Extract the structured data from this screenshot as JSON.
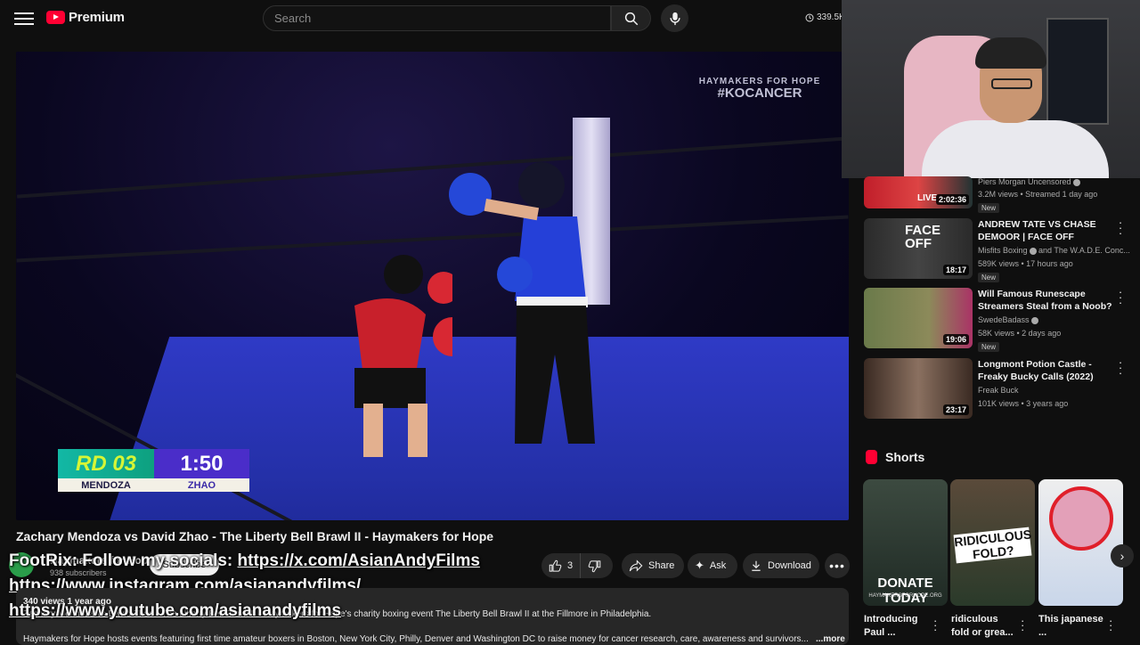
{
  "header": {
    "logo_text": "Premium",
    "search_placeholder": "Search",
    "viewers": "339.5K"
  },
  "video": {
    "title": "Zachary Mendoza vs David Zhao - The Liberty Bell Brawl II - Haymakers for Hope",
    "sponsor_line1": "HAYMAKERS FOR HOPE",
    "sponsor_line2": "#KOCANCER",
    "scoreboard": {
      "round": "RD 03",
      "time": "1:50",
      "fighter1": "MENDOZA",
      "fighter2": "ZHAO"
    }
  },
  "channel": {
    "name": "Haymakers for Hope",
    "subs": "938 subscribers",
    "subscribe_label": "Subscribe"
  },
  "overlay": {
    "line1_prefix": "FootRix: Follow my socials: ",
    "line1_link": "https://x.com/AsianAndyFilms",
    "line2": "https://www.instagram.com/asianandyfilms/",
    "line3": "https://www.youtube.com/asianandyfilms"
  },
  "actions": {
    "likes": "3",
    "share": "Share",
    "ask": "Ask",
    "download": "Download"
  },
  "description": {
    "meta": "340 views  1 year ago",
    "line1": "Zachary Mendoza vs David Zhao - The Liberty Bell Brawl II - Haymakers for Hope's charity boxing event The Liberty Bell Brawl II at the Fillmore in Philadelphia.",
    "line2": "Haymakers for Hope hosts events featuring first time amateur boxers in Boston, New York City, Philly, Denver and Washington DC to raise money for cancer research, care, awareness and survivors...",
    "more": "...more"
  },
  "recommendations": [
    {
      "title": "",
      "channel": "Piers Morgan Uncensored",
      "meta": "3.2M views • Streamed 1 day ago",
      "duration": "2:02:36",
      "badge": "New",
      "live": "LIVE"
    },
    {
      "title": "ANDREW TATE VS CHASE DEMOOR | FACE OFF",
      "channel": "Misfits Boxing",
      "channel_extra": "and The W.A.D.E. Conc...",
      "meta": "589K views • 17 hours ago",
      "duration": "18:17",
      "badge": "New",
      "thumb_text": "FACE OFF"
    },
    {
      "title": "Will Famous Runescape Streamers Steal from a Noob?",
      "channel": "SwedeBadass",
      "meta": "58K views • 2 days ago",
      "duration": "19:06",
      "badge": "New"
    },
    {
      "title": "Longmont Potion Castle - Freaky Bucky Calls (2022)",
      "channel": "Freak Buck",
      "meta": "101K views • 3 years ago",
      "duration": "23:17"
    }
  ],
  "shorts": {
    "heading": "Shorts",
    "items": [
      {
        "title": "Introducing Paul ...",
        "thumb_text": "DONATE TODAY",
        "thumb_sub": "HAYMAKERSFORHOPE.ORG"
      },
      {
        "title": "ridiculous fold or grea...",
        "thumb_text": "RIDICULOUS FOLD?"
      },
      {
        "title": "This japanese ..."
      }
    ]
  },
  "colors": {
    "accent": "#ff0033",
    "bg": "#0f0f0f",
    "chip": "#272727",
    "ring": "#2f3ac6"
  }
}
